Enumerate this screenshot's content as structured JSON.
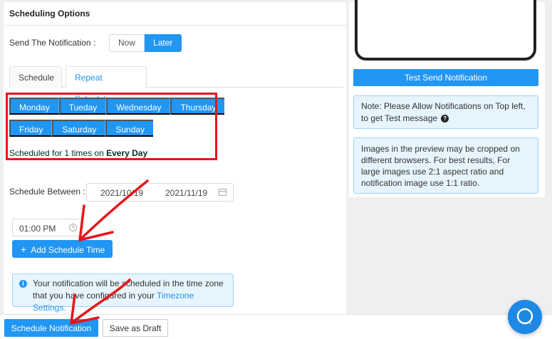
{
  "panel": {
    "title": "Scheduling Options"
  },
  "send": {
    "label": "Send The Notification :",
    "options": [
      "Now",
      "Later"
    ],
    "selected": "Later"
  },
  "tabs": [
    {
      "label": "Schedule",
      "active": false
    },
    {
      "label": "Repeat Schedule",
      "active": true
    }
  ],
  "days": {
    "row1": [
      "Monday",
      "Tueday",
      "Wednesday",
      "Thursday"
    ],
    "row2": [
      "Friday",
      "Saturday",
      "Sunday"
    ]
  },
  "summary": {
    "prefix": "Scheduled for 1 times on ",
    "emphasis": "Every Day"
  },
  "schedule_between": {
    "label": "Schedule Between :",
    "start": "2021/10/19",
    "end": "2021/11/19"
  },
  "time": {
    "value": "01:00 PM"
  },
  "add_time": {
    "label": "Add Schedule Time"
  },
  "tz_info": {
    "text": "Your notification will be scheduled in the time zone that you have configured in your ",
    "link": "Timezone Settings."
  },
  "right": {
    "test_button": "Test Send Notification",
    "note": "Note: Please Allow Notifications on Top left, to get Test message",
    "image_warning": "Images in the preview may be cropped on different browsers. For best results, For large images use 2:1 aspect ratio and notification image use 1:1 ratio."
  },
  "footer": {
    "primary": "Schedule Notification",
    "secondary": "Save as Draft"
  },
  "colors": {
    "accent": "#2196f3",
    "annotation": "#e6151c",
    "info_bg": "#e6f4fd"
  }
}
